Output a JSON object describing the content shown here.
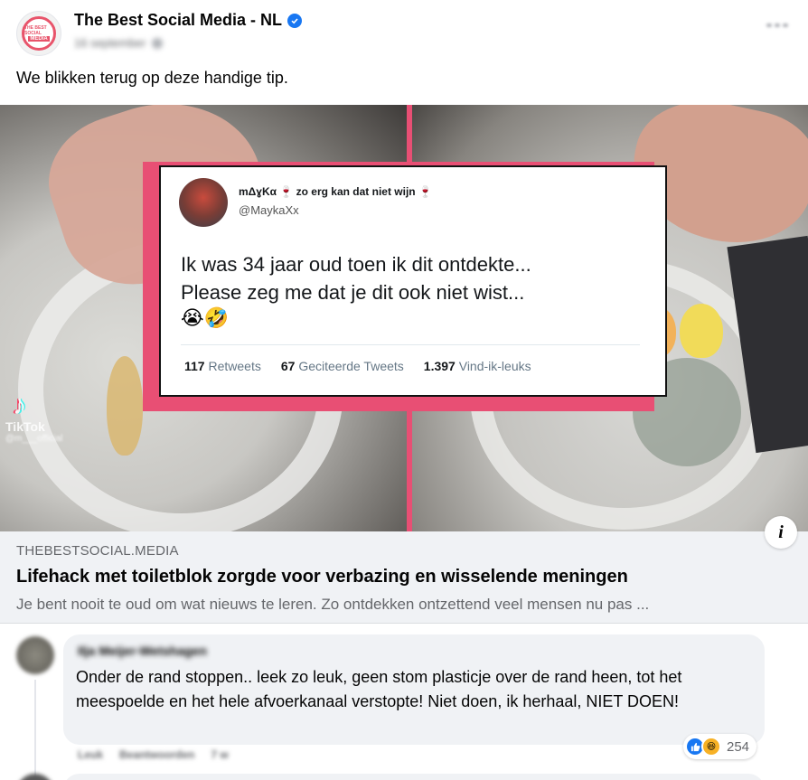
{
  "post": {
    "page_name": "The Best Social Media - NL",
    "avatar_text_top": "THE BEST SOCIAL",
    "avatar_text_brand": "MEDIA",
    "date": "16 september",
    "text": "We blikken terug op deze handige tip."
  },
  "image": {
    "tiktok_label": "TikTok",
    "tiktok_handle": "@m___official",
    "tweet": {
      "name": "mΔɣKα 🍷 zo erg kan dat niet wijn 🍷",
      "handle": "@MaykaXx",
      "line1": "Ik was 34 jaar oud toen ik dit ontdekte...",
      "line2": "Please zeg me dat je dit ook niet wist...",
      "emoji": "😭🤣",
      "retweets_count": "117",
      "retweets_label": "Retweets",
      "quotes_count": "67",
      "quotes_label": "Geciteerde Tweets",
      "likes_count": "1.397",
      "likes_label": "Vind-ik-leuks"
    }
  },
  "link_preview": {
    "domain": "THEBESTSOCIAL.MEDIA",
    "title": "Lifehack met toiletblok zorgde voor verbazing en wisselende meningen",
    "description": "Je bent nooit te oud om wat nieuws te leren. Zo ontdekken ontzettend veel mensen nu pas ..."
  },
  "comment": {
    "author": "Ilja Meijer-Wetshagen",
    "text": "Onder de rand stoppen.. leek zo leuk, geen stom plasticje over de rand heen, tot het meespoelde en het hele afvoerkanaal verstopte! Niet doen, ik herhaal, NIET DOEN!",
    "reaction_count": "254",
    "like_action": "Leuk",
    "reply_action": "Beantwoorden",
    "time": "7 w"
  },
  "colors": {
    "accent": "#1877f2",
    "brand_pink": "#e84f74",
    "bubble_bg": "#f0f2f5"
  }
}
